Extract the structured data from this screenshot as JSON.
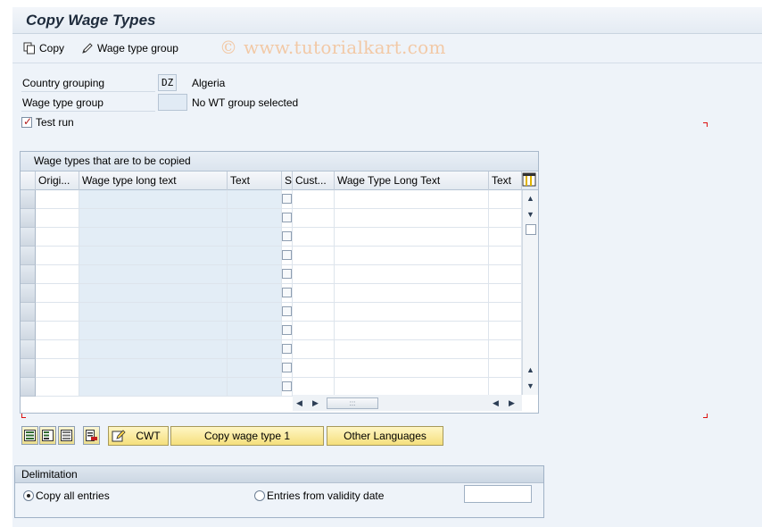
{
  "window": {
    "title": "Copy Wage Types"
  },
  "toolbar": {
    "copy_label": "Copy",
    "wage_type_group_label": "Wage type group"
  },
  "watermark": "© www.tutorialkart.com",
  "form": {
    "country_grouping_label": "Country grouping",
    "country_grouping_value": "DZ",
    "country_name": "Algeria",
    "wage_type_group_label": "Wage type group",
    "wage_type_group_value": "",
    "wage_type_group_status": "No WT group selected",
    "test_run_label": "Test run",
    "test_run_checked": true
  },
  "table": {
    "title": "Wage types that are to be copied",
    "columns": [
      "Origi...",
      "Wage type long text",
      "Text",
      "S",
      "Cust...",
      "Wage Type Long Text",
      "Text"
    ],
    "row_count": 11,
    "grid_handle": ":::"
  },
  "buttons": {
    "cwt_label": "CWT",
    "copy_wage_type_label": "Copy wage type 1",
    "other_languages_label": "Other Languages"
  },
  "delimitation": {
    "title": "Delimitation",
    "copy_all_label": "Copy all entries",
    "entries_from_validity_label": "Entries from validity date",
    "validity_date_value": "",
    "selected": "copy_all"
  },
  "colors": {
    "accent_yellow": "#f5df7c",
    "readonly_blue": "#e3edf6",
    "required_marker": "#dd1111"
  }
}
